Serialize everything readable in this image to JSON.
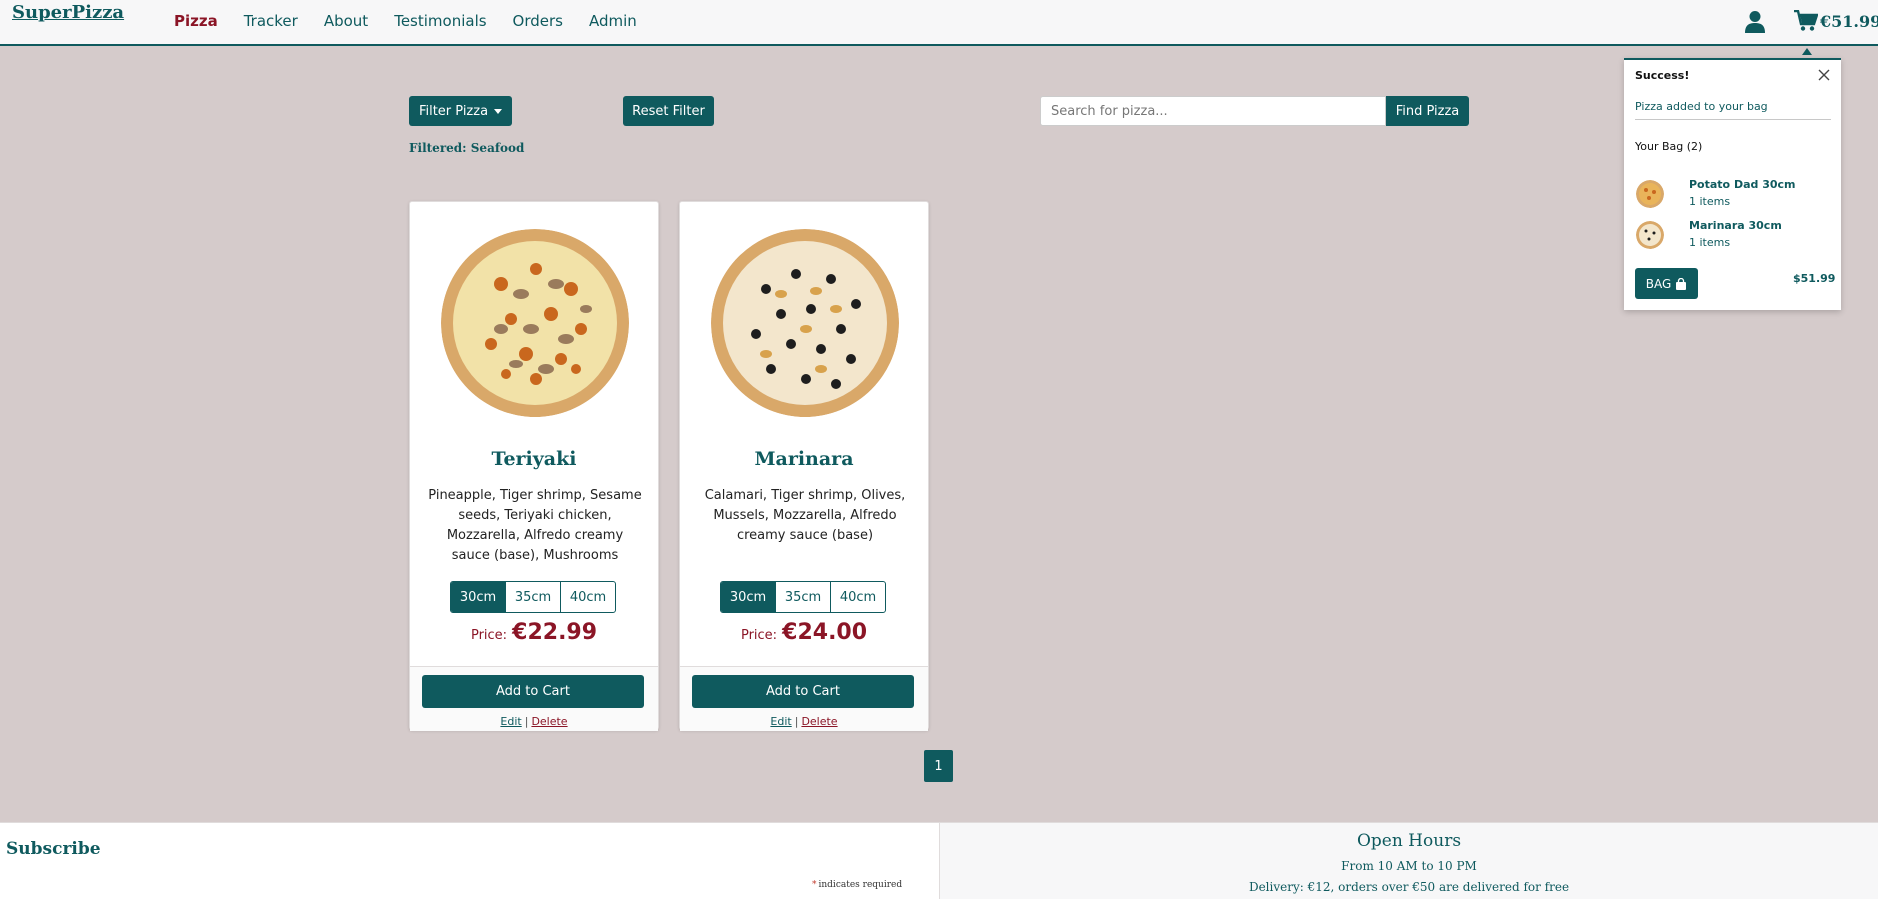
{
  "brand": "SuperPizza",
  "nav": {
    "items": [
      {
        "label": "Pizza",
        "active": true
      },
      {
        "label": "Tracker"
      },
      {
        "label": "About"
      },
      {
        "label": "Testimonials"
      },
      {
        "label": "Orders"
      },
      {
        "label": "Admin"
      }
    ],
    "user_icon": "user-icon",
    "cart_icon": "shopping-cart-icon",
    "cart_total": "€51.99"
  },
  "filters": {
    "filter_label": "Filter Pizza",
    "reset_label": "Reset Filter",
    "filtered_text": "Filtered: Seafood",
    "search_placeholder": "Search for pizza...",
    "search_value": "",
    "find_label": "Find Pizza"
  },
  "products": [
    {
      "name": "Teriyaki",
      "description": "Pineapple, Tiger shrimp, Sesame seeds, Teriyaki chicken, Mozzarella, Alfredo creamy sauce (base), Mushrooms",
      "sizes": [
        "30cm",
        "35cm",
        "40cm"
      ],
      "selected_size": "30cm",
      "price_label": "Price:",
      "price": "€22.99",
      "add_label": "Add to Cart",
      "edit_label": "Edit",
      "delete_label": "Delete"
    },
    {
      "name": "Marinara",
      "description": "Calamari, Tiger shrimp, Olives, Mussels, Mozzarella, Alfredo creamy sauce (base)",
      "sizes": [
        "30cm",
        "35cm",
        "40cm"
      ],
      "selected_size": "30cm",
      "price_label": "Price:",
      "price": "€24.00",
      "add_label": "Add to Cart",
      "edit_label": "Edit",
      "delete_label": "Delete"
    }
  ],
  "pagination": {
    "current": "1"
  },
  "toast": {
    "title": "Success!",
    "message": "Pizza added to your bag",
    "bag_count": "Your Bag (2)",
    "items": [
      {
        "name": "Potato Dad 30cm",
        "qty": "1 items"
      },
      {
        "name": "Marinara 30cm",
        "qty": "1 items"
      }
    ],
    "bag_label": "BAG",
    "total": "$51.99"
  },
  "footer": {
    "subscribe": "Subscribe",
    "required_note": "indicates required",
    "open_hours_title": "Open Hours",
    "hours": "From 10 AM to 10 PM",
    "delivery": "Delivery: €12, orders over €50 are delivered for free"
  },
  "colors": {
    "primary": "#0f5a5e",
    "accent": "#8b1526",
    "background": "#d5cbcb"
  }
}
